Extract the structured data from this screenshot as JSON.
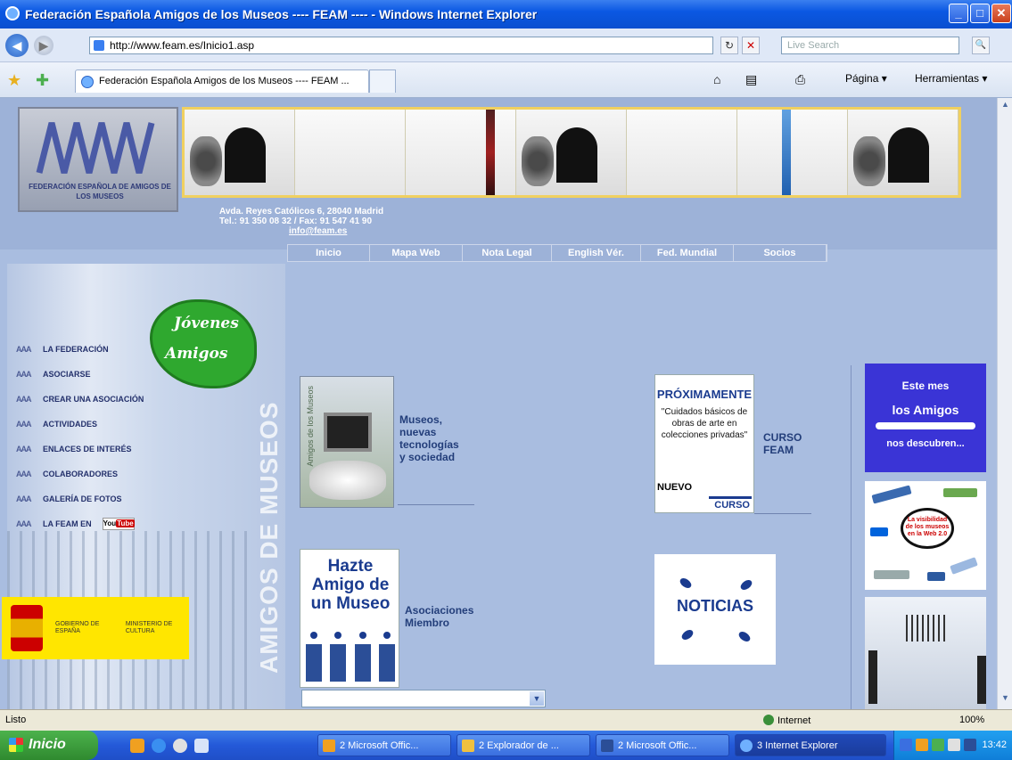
{
  "window": {
    "title": "Federación Española Amigos de los Museos ---- FEAM ---- - Windows Internet Explorer",
    "minimize": "_",
    "maximize": "□",
    "close": "✕"
  },
  "address_bar": {
    "url": "http://www.feam.es/Inicio1.asp",
    "search_placeholder": "Live Search",
    "back": "◀",
    "forward": "▶",
    "refresh": "↻",
    "stop": "✕",
    "search_go": "🔍"
  },
  "tabs": {
    "active_label": "Federación Española Amigos de los Museos ---- FEAM ...",
    "home_icon": "⌂",
    "feeds_icon": "▤",
    "print_icon": "⎙",
    "page_menu": "Página ▾",
    "tools_menu": "Herramientas ▾"
  },
  "site": {
    "logo_text": "FEDERACIÓN ESPAÑOLA DE AMIGOS DE LOS MUSEOS",
    "address_line1": "Avda. Reyes Católicos 6, 28040 Madrid",
    "address_line2": "Tel.: 91 350 08 32 / Fax: 91 547 41 90",
    "email": "info@feam.es",
    "top_nav": [
      "Inicio",
      "Mapa Web",
      "Nota Legal",
      "English Vér.",
      "Fed. Mundial",
      "Socios"
    ],
    "vertical_text": "AMIGOS DE MUSEOS",
    "jovenes": [
      "Jóvenes",
      "Amigos"
    ],
    "menu": [
      "LA FEDERACIÓN",
      "ASOCIARSE",
      "CREAR UNA ASOCIACIÓN",
      "ACTIVIDADES",
      "ENLACES DE INTERÉS",
      "COLABORADORES",
      "GALERÍA DE FOTOS",
      "LA FEAM EN"
    ],
    "menu_bullet": "AAA",
    "youtube_label": "You",
    "youtube_tube": "Tube",
    "gobierno": "GOBIERNO DE ESPAÑA",
    "ministerio": "MINISTERIO DE CULTURA",
    "book_spine": "Amigos de los Museos",
    "museos_caption": [
      "Museos,",
      "nuevas",
      "tecnologías",
      "y sociedad"
    ],
    "proximamente": {
      "heading": "PRÓXIMAMENTE",
      "body": "\"Cuidados básicos de obras de arte en colecciones privadas\"",
      "nuevo": "NUEVO",
      "curso": "CURSO"
    },
    "curso_caption": [
      "CURSO",
      "FEAM"
    ],
    "hazte": [
      "Hazte",
      "Amigo de",
      "un Museo"
    ],
    "asociaciones_caption": [
      "Asociaciones",
      "Miembro"
    ],
    "noticias": "NOTICIAS",
    "este_mes": {
      "line1": "Este mes",
      "line2": "los Amigos",
      "line3": "nos descubren..."
    },
    "web20_text": "La visibilidad de los museos en la Web 2.0",
    "select_arrow": "▼"
  },
  "status_bar": {
    "status": "Listo",
    "zone": "Internet",
    "zoom": "100%"
  },
  "taskbar": {
    "start": "Inicio",
    "tasks": [
      "2 Microsoft Offic...",
      "2 Explorador de ...",
      "2 Microsoft Offic...",
      "3 Internet Explorer"
    ],
    "clock": "13:42"
  }
}
